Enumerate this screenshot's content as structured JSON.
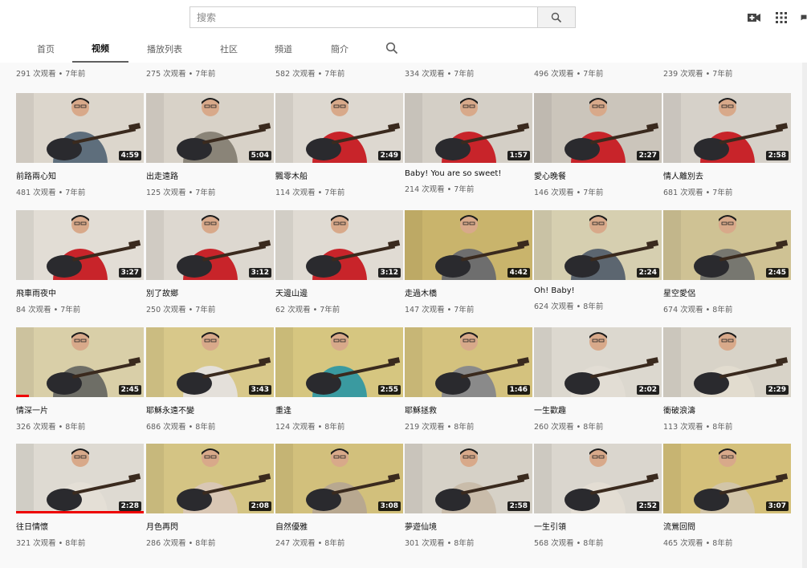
{
  "search": {
    "placeholder": "搜索"
  },
  "tabs": [
    {
      "label": "首页",
      "active": false
    },
    {
      "label": "视频",
      "active": true
    },
    {
      "label": "播放列表",
      "active": false
    },
    {
      "label": "社区",
      "active": false
    },
    {
      "label": "頻道",
      "active": false
    },
    {
      "label": "簡介",
      "active": false
    }
  ],
  "top_row_meta": [
    "291 次观看 • 7年前",
    "275 次观看 • 7年前",
    "582 次观看 • 7年前",
    "334 次观看 • 7年前",
    "496 次观看 • 7年前",
    "239 次观看 • 7年前"
  ],
  "videos": [
    [
      {
        "title": "前路兩心知",
        "meta": "481 次观看 • 7年前",
        "duration": "4:59",
        "shirt": "#5e6e7c",
        "bg": "#dcd6cc"
      },
      {
        "title": "出走遠路",
        "meta": "125 次观看 • 7年前",
        "duration": "5:04",
        "shirt": "#8a8478",
        "bg": "#d8d2c8"
      },
      {
        "title": "飄零木船",
        "meta": "114 次观看 • 7年前",
        "duration": "2:49",
        "shirt": "#c8242a",
        "bg": "#ddd8d0"
      },
      {
        "title": "Baby! You are so sweet!",
        "meta": "214 次观看 • 7年前",
        "duration": "1:57",
        "shirt": "#c8242a",
        "bg": "#d4cfc6"
      },
      {
        "title": "愛心晚餐",
        "meta": "146 次观看 • 7年前",
        "duration": "2:27",
        "shirt": "#c8242a",
        "bg": "#cbc5bb"
      },
      {
        "title": "情人離別去",
        "meta": "681 次观看 • 7年前",
        "duration": "2:58",
        "shirt": "#c8242a",
        "bg": "#d6d1c9"
      }
    ],
    [
      {
        "title": "飛車雨夜中",
        "meta": "84 次观看 • 7年前",
        "duration": "3:27",
        "shirt": "#c8242a",
        "bg": "#e2ddd5"
      },
      {
        "title": "別了故鄉",
        "meta": "250 次观看 • 7年前",
        "duration": "3:12",
        "shirt": "#c8242a",
        "bg": "#ddd8d0"
      },
      {
        "title": "天邊山邊",
        "meta": "62 次观看 • 7年前",
        "duration": "3:12",
        "shirt": "#c8242a",
        "bg": "#e0dbd3"
      },
      {
        "title": "走過木橋",
        "meta": "147 次观看 • 7年前",
        "duration": "4:42",
        "shirt": "#6e6e6e",
        "bg": "#c9b46c"
      },
      {
        "title": "Oh! Baby!",
        "meta": "624 次观看 • 8年前",
        "duration": "2:24",
        "shirt": "#5c6670",
        "bg": "#d6cfb0"
      },
      {
        "title": "星空愛侶",
        "meta": "674 次观看 • 8年前",
        "duration": "2:45",
        "shirt": "#777770",
        "bg": "#cfc294"
      }
    ],
    [
      {
        "title": "情深一片",
        "meta": "326 次观看 • 8年前",
        "duration": "2:45",
        "shirt": "#6e6e66",
        "bg": "#d9cfa8",
        "progress": 0.1
      },
      {
        "title": "耶穌永遠不變",
        "meta": "686 次观看 • 8年前",
        "duration": "3:43",
        "shirt": "#e4e0da",
        "bg": "#d8c88a"
      },
      {
        "title": "重逢",
        "meta": "124 次观看 • 8年前",
        "duration": "2:55",
        "shirt": "#3a9aa0",
        "bg": "#d6c680"
      },
      {
        "title": "耶穌拯救",
        "meta": "219 次观看 • 8年前",
        "duration": "1:46",
        "shirt": "#8a8a8a",
        "bg": "#d4c27e"
      },
      {
        "title": "一生歡趣",
        "meta": "260 次观看 • 8年前",
        "duration": "2:02",
        "shirt": "#e2ddd4",
        "bg": "#dcd8cf"
      },
      {
        "title": "衝破浪濤",
        "meta": "113 次观看 • 8年前",
        "duration": "2:29",
        "shirt": "#e2dccf",
        "bg": "#d8d3c8"
      }
    ],
    [
      {
        "title": "往日情懷",
        "meta": "321 次观看 • 8年前",
        "duration": "2:28",
        "shirt": "#e4dfd6",
        "bg": "#dedad2",
        "progress": 1.0
      },
      {
        "title": "月色再閃",
        "meta": "286 次观看 • 8年前",
        "duration": "2:08",
        "shirt": "#d9c7b4",
        "bg": "#d4c484"
      },
      {
        "title": "自然優雅",
        "meta": "247 次观看 • 8年前",
        "duration": "3:08",
        "shirt": "#b8a890",
        "bg": "#d2c07c"
      },
      {
        "title": "夢遊仙境",
        "meta": "301 次观看 • 8年前",
        "duration": "2:58",
        "shirt": "#c9bcaa",
        "bg": "#d6d1c7"
      },
      {
        "title": "一生引領",
        "meta": "568 次观看 • 8年前",
        "duration": "2:52",
        "shirt": "#e3ddd3",
        "bg": "#dad6ce"
      },
      {
        "title": "流鶯回問",
        "meta": "465 次观看 • 8年前",
        "duration": "3:07",
        "shirt": "#d2c5a8",
        "bg": "#d4c07a"
      }
    ]
  ]
}
